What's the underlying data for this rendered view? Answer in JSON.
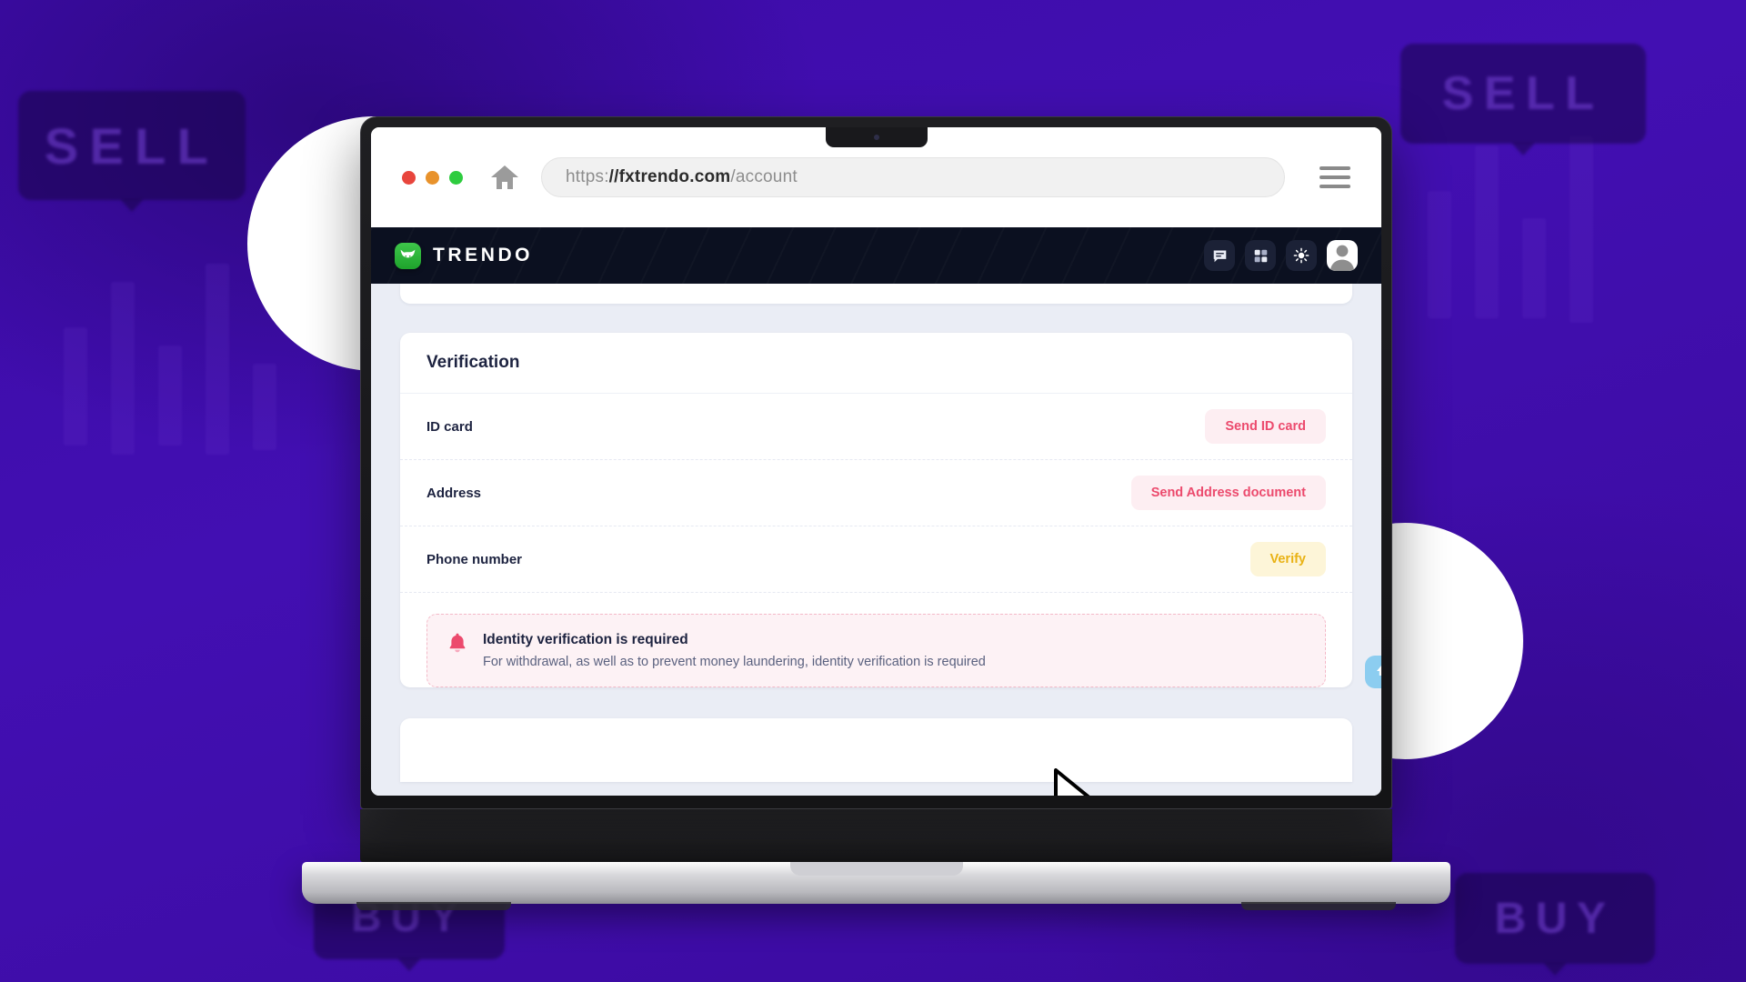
{
  "background": {
    "badges": [
      {
        "id": "bgSell1",
        "label": "SELL"
      },
      {
        "id": "bgSell2",
        "label": "SELL"
      },
      {
        "id": "bgBuy1",
        "label": "BUY"
      },
      {
        "id": "bgBuy2",
        "label": "BUY"
      }
    ],
    "color": "#3b0a9e"
  },
  "browser": {
    "traffic_lights": [
      "close",
      "minimize",
      "maximize"
    ],
    "home_icon": "home-icon",
    "menu_icon": "hamburger-menu-icon",
    "url": {
      "scheme": "https:",
      "sep": "//",
      "domain": "fxtrendo.com",
      "slash": "/",
      "path": "account",
      "full": "https://fxtrendo.com/account"
    }
  },
  "navbar": {
    "brand_name": "TRENDO",
    "brand_icon": "bull-logo-icon",
    "brand_color": "#2ea83a",
    "actions": [
      {
        "name": "chat-icon",
        "label": "Chat"
      },
      {
        "name": "apps-grid-icon",
        "label": "Apps"
      },
      {
        "name": "theme-toggle-sun-icon",
        "label": "Theme"
      },
      {
        "name": "avatar",
        "label": "Profile"
      }
    ]
  },
  "verification_card": {
    "title": "Verification",
    "rows": [
      {
        "label": "ID card",
        "action": "Send ID card",
        "style": "pink"
      },
      {
        "label": "Address",
        "action": "Send Address document",
        "style": "pink"
      },
      {
        "label": "Phone number",
        "action": "Verify",
        "style": "amber"
      }
    ],
    "alert": {
      "icon": "bell-icon",
      "title": "Identity verification is required",
      "text": "For withdrawal, as well as to prevent money laundering, identity verification is required",
      "accent": "#ec4a6d",
      "background": "#fdf2f5"
    }
  },
  "scroll_top_button": {
    "icon": "arrow-up-icon",
    "color": "#8ccdf0"
  },
  "colors": {
    "pink_button_bg": "#fdeef2",
    "pink_button_text": "#ec4a6d",
    "amber_button_bg": "#fdf5d8",
    "amber_button_text": "#e9b214",
    "navbar_bg": "#0b1020",
    "page_bg": "#eaedf5",
    "heading": "#1d2340"
  }
}
